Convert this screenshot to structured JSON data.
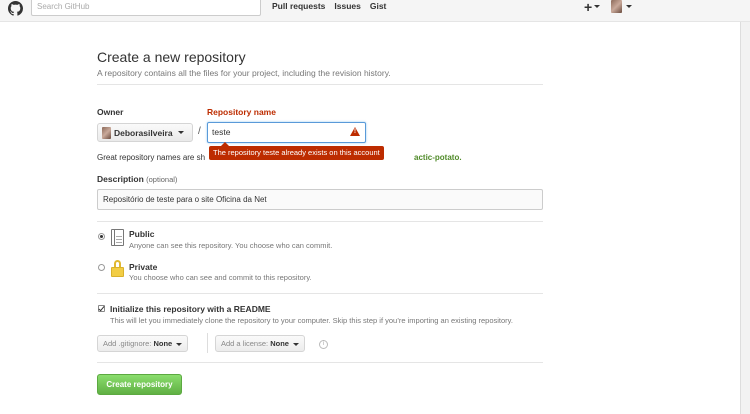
{
  "header": {
    "search_placeholder": "Search GitHub",
    "nav": [
      "Pull requests",
      "Issues",
      "Gist"
    ],
    "plus": "+"
  },
  "page": {
    "title": "Create a new repository",
    "subtitle": "A repository contains all the files for your project, including the revision history."
  },
  "form": {
    "owner_label": "Owner",
    "owner_value": "Deborasilveira",
    "repo_label": "Repository name",
    "repo_value": "teste",
    "error_tooltip": "The repository teste already exists on this account",
    "hint_left": "Great repository names are sh",
    "hint_right": "actic-potato.",
    "description_label": "Description",
    "description_optional": "(optional)",
    "description_value": "Repositório de teste para o site Oficina da Net",
    "visibility": {
      "selected": "Public",
      "public_title": "Public",
      "public_desc": "Anyone can see this repository. You choose who can commit.",
      "private_title": "Private",
      "private_desc": "You choose who can see and commit to this repository."
    },
    "init_readme": {
      "checked": true,
      "title": "Initialize this repository with a README",
      "desc": "This will let you immediately clone the repository to your computer. Skip this step if you’re importing an existing repository."
    },
    "gitignore": {
      "label": "Add .gitignore:",
      "value": "None"
    },
    "license": {
      "label": "Add a license:",
      "value": "None"
    },
    "info_icon": "i",
    "submit_label": "Create repository"
  },
  "colors": {
    "error": "#bd2c00",
    "submit": "#60b044",
    "hint_green": "#4f8a28"
  }
}
